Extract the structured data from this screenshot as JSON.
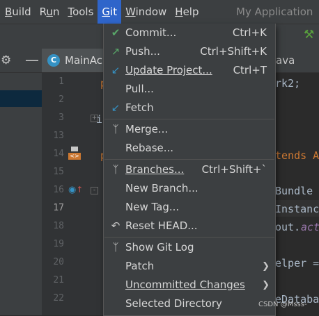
{
  "menubar": {
    "items": [
      "Build",
      "Run",
      "Tools",
      "Git",
      "Window",
      "Help"
    ],
    "app_title": "My Application"
  },
  "editor": {
    "tab_label": "MainAc",
    "second_tab_label": "ava",
    "line_numbers": [
      "1",
      "2",
      "3",
      "13",
      "14",
      "15",
      "16",
      "17",
      "18",
      "19",
      "20",
      "21",
      "22"
    ],
    "current_line": "17",
    "code_fragments": {
      "l1": "rk2;",
      "l14": "tends A",
      "l16": "Bundle",
      "l17": "Instanc",
      "l18": "out.",
      "l18b": "act",
      "l20": "elper =",
      "l22": "eDataba",
      "left_p1": "p",
      "left_i": "i",
      "left_p2": "p"
    }
  },
  "git_menu": {
    "items": [
      {
        "label": "Commit...",
        "shortcut": "Ctrl+K",
        "icon": "check-icon"
      },
      {
        "label": "Push...",
        "shortcut": "Ctrl+Shift+K",
        "icon": "push-arrow-icon"
      },
      {
        "label": "Update Project...",
        "shortcut": "Ctrl+T",
        "icon": "update-arrow-icon"
      },
      {
        "label": "Pull...",
        "shortcut": "",
        "icon": ""
      },
      {
        "label": "Fetch",
        "shortcut": "",
        "icon": "fetch-arrow-icon"
      },
      {
        "label": "Merge...",
        "shortcut": "",
        "icon": "merge-icon"
      },
      {
        "label": "Rebase...",
        "shortcut": "",
        "icon": ""
      },
      {
        "label": "Branches...",
        "shortcut": "Ctrl+Shift+`",
        "icon": "branch-icon"
      },
      {
        "label": "New Branch...",
        "shortcut": "",
        "icon": ""
      },
      {
        "label": "New Tag...",
        "shortcut": "",
        "icon": ""
      },
      {
        "label": "Reset HEAD...",
        "shortcut": "",
        "icon": "reset-icon"
      },
      {
        "label": "Show Git Log",
        "shortcut": "",
        "icon": "git-log-icon"
      },
      {
        "label": "Patch",
        "shortcut": "",
        "icon": ""
      },
      {
        "label": "Uncommitted Changes",
        "shortcut": "",
        "icon": ""
      },
      {
        "label": "Selected Directory",
        "shortcut": "",
        "icon": ""
      }
    ]
  },
  "watermark": "CSDN @Msss-",
  "colors": {
    "menu_bg": "#3c3f41",
    "active_menu": "#2f65ca",
    "editor_bg": "#2b2b2b",
    "check_green": "#59a869",
    "arrow_blue": "#3592c4"
  }
}
